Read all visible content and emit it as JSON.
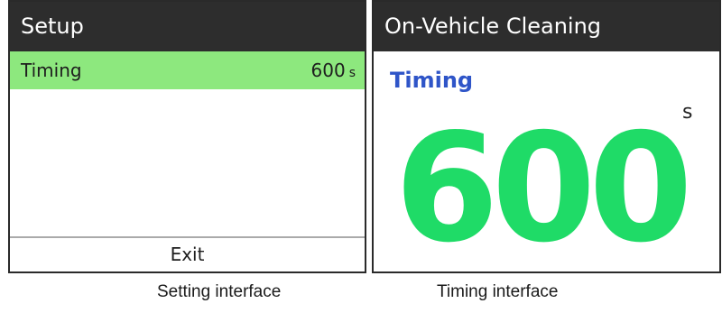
{
  "setup_screen": {
    "title": "Setup",
    "menu": {
      "label": "Timing",
      "value": "600",
      "unit": "s"
    },
    "exit_label": "Exit",
    "caption": "Setting interface"
  },
  "timing_screen": {
    "title": "On-Vehicle Cleaning",
    "label": "Timing",
    "unit": "s",
    "value": "600",
    "caption": "Timing interface"
  },
  "colors": {
    "titlebar": "#2d2d2d",
    "highlight_row": "#8de87e",
    "timing_label": "#2f55c8",
    "timing_value": "#1fdb67"
  }
}
